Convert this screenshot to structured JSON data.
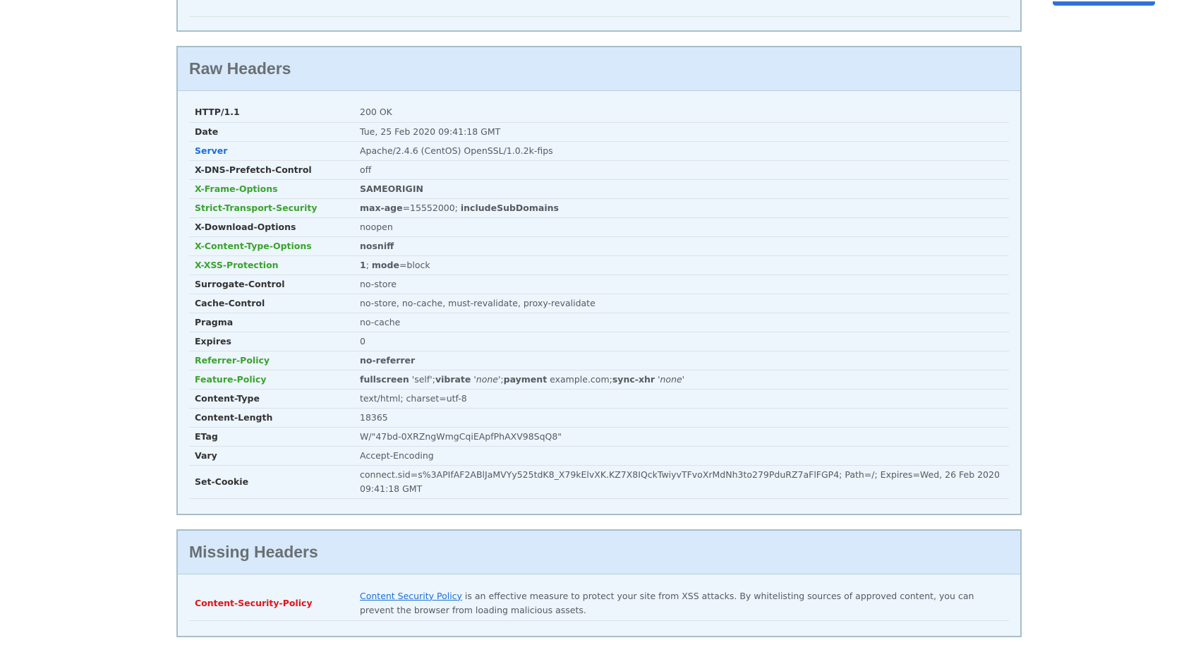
{
  "raw_headers": {
    "title": "Raw Headers",
    "rows": [
      {
        "name": "HTTP/1.1",
        "value": "200 OK",
        "color": "#333333"
      },
      {
        "name": "Date",
        "value": "Tue, 25 Feb 2020 09:41:18 GMT",
        "color": "#333333"
      },
      {
        "name": "Server",
        "value": "Apache/2.4.6 (CentOS) OpenSSL/1.0.2k-fips",
        "color": "#1a6fd8"
      },
      {
        "name": "X-DNS-Prefetch-Control",
        "value": "off",
        "color": "#333333"
      },
      {
        "name": "X-Frame-Options",
        "value": "SAMEORIGIN",
        "color": "#3aa32e"
      },
      {
        "name": "Strict-Transport-Security",
        "value": "max-age=15552000; includeSubDomains",
        "color": "#3aa32e"
      },
      {
        "name": "X-Download-Options",
        "value": "noopen",
        "color": "#333333"
      },
      {
        "name": "X-Content-Type-Options",
        "value": "nosniff",
        "color": "#3aa32e"
      },
      {
        "name": "X-XSS-Protection",
        "value": "1; mode=block",
        "color": "#3aa32e"
      },
      {
        "name": "Surrogate-Control",
        "value": "no-store",
        "color": "#333333"
      },
      {
        "name": "Cache-Control",
        "value": "no-store, no-cache, must-revalidate, proxy-revalidate",
        "color": "#333333"
      },
      {
        "name": "Pragma",
        "value": "no-cache",
        "color": "#333333"
      },
      {
        "name": "Expires",
        "value": "0",
        "color": "#333333"
      },
      {
        "name": "Referrer-Policy",
        "value": "no-referrer",
        "color": "#3aa32e"
      },
      {
        "name": "Feature-Policy",
        "value": "fullscreen 'self';vibrate 'none';payment example.com;sync-xhr 'none'",
        "color": "#3aa32e"
      },
      {
        "name": "Content-Type",
        "value": "text/html; charset=utf-8",
        "color": "#333333"
      },
      {
        "name": "Content-Length",
        "value": "18365",
        "color": "#333333"
      },
      {
        "name": "ETag",
        "value": "W/\"47bd-0XRZngWmgCqiEApfPhAXV98SqQ8\"",
        "color": "#333333"
      },
      {
        "name": "Vary",
        "value": "Accept-Encoding",
        "color": "#333333"
      },
      {
        "name": "Set-Cookie",
        "value": "connect.sid=s%3APIfAF2ABlJaMVYy525tdK8_X79kElvXK.KZ7X8IQckTwiyvTFvoXrMdNh3to279PduRZ7aFlFGP4; Path=/; Expires=Wed, 26 Feb 2020 09:41:18 GMT",
        "color": "#333333"
      }
    ]
  },
  "missing_headers": {
    "title": "Missing Headers",
    "rows": [
      {
        "name": "Content-Security-Policy",
        "link_text": "Content Security Policy",
        "description": " is an effective measure to protect your site from XSS attacks. By whitelisting sources of approved content, you can prevent the browser from loading malicious assets.",
        "color": "#e0161b"
      }
    ]
  }
}
